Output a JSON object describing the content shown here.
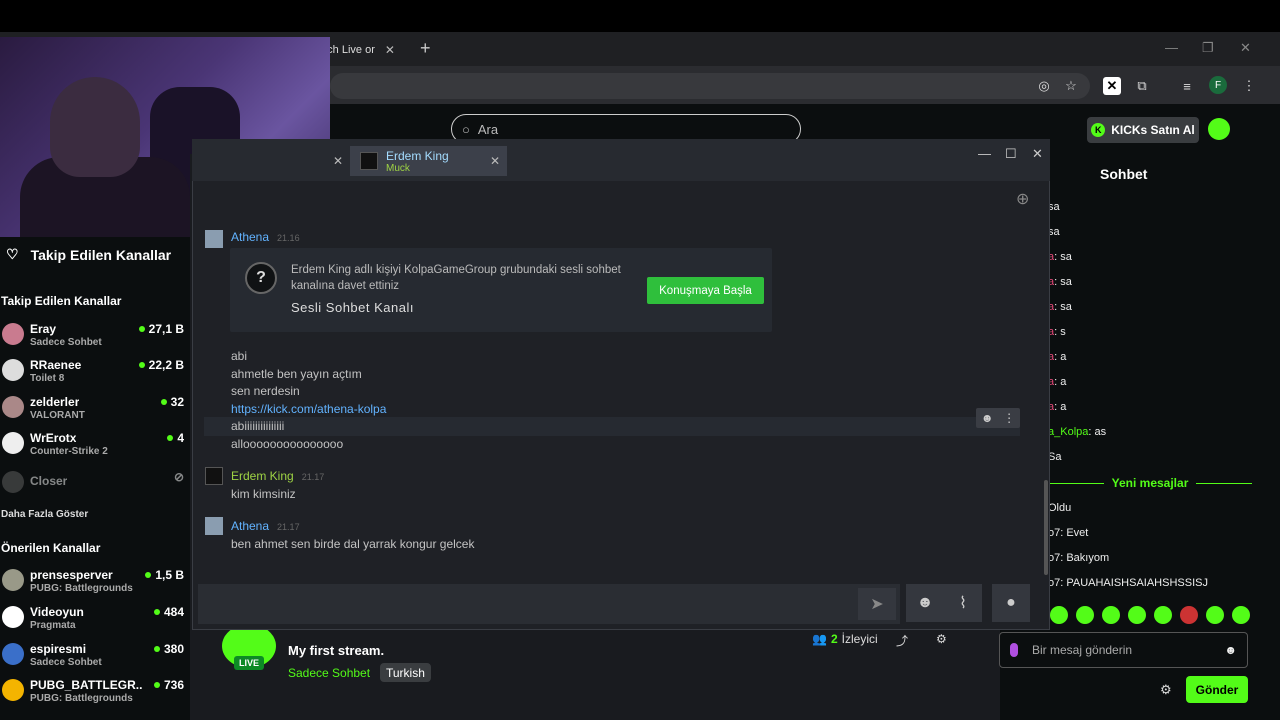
{
  "browser": {
    "tab_title": "atch Live or",
    "tab_close": "✕",
    "new_tab": "+",
    "profile_initial": "F",
    "win_min": "—",
    "win_max": "❐",
    "win_close": "✕"
  },
  "site": {
    "search_placeholder": "Ara",
    "kicks_label": "KICKs Satın Al",
    "kicks_glyph": "K"
  },
  "sidebar": {
    "header": "Takip Edilen Kanallar",
    "followed_title": "Takip Edilen Kanallar",
    "followed": [
      {
        "name": "Eray",
        "category": "Sadece Sohbet",
        "viewers": "27,1 B"
      },
      {
        "name": "RRaenee",
        "category": "Toilet 8",
        "viewers": "22,2 B"
      },
      {
        "name": "zelderler",
        "category": "VALORANT",
        "viewers": "32"
      },
      {
        "name": "WrErotx",
        "category": "Counter-Strike 2",
        "viewers": "4"
      },
      {
        "name": "Closer",
        "category": "",
        "viewers": ""
      }
    ],
    "show_more": "Daha Fazla Göster",
    "recommended_title": "Önerilen Kanallar",
    "recommended": [
      {
        "name": "prensesperver",
        "category": "PUBG: Battlegrounds",
        "viewers": "1,5 B"
      },
      {
        "name": "Videoyun",
        "category": "Pragmata",
        "viewers": "484"
      },
      {
        "name": "espiresmi",
        "category": "Sadece Sohbet",
        "viewers": "380"
      },
      {
        "name": "PUBG_BATTLEGR...",
        "category": "PUBG: Battlegrounds",
        "viewers": "736"
      }
    ]
  },
  "stream": {
    "live": "LIVE",
    "title": "My first stream.",
    "category": "Sadece Sohbet",
    "tag": "Turkish",
    "viewers_count": "2",
    "viewers_label": "İzleyici"
  },
  "chat": {
    "title": "Sohbet",
    "lines": [
      {
        "user": "",
        "text": "sa"
      },
      {
        "user": "",
        "text": "sa"
      },
      {
        "user": "a",
        "text": ": sa"
      },
      {
        "user": "a",
        "text": ": sa"
      },
      {
        "user": "a",
        "text": ": sa"
      },
      {
        "user": "a",
        "text": ": s"
      },
      {
        "user": "a",
        "text": ": a"
      },
      {
        "user": "a",
        "text": ": a"
      },
      {
        "user": "a",
        "text": ": a"
      },
      {
        "user": "a_Kolpa",
        "text": ": as"
      },
      {
        "user": "",
        "text": "Sa"
      }
    ],
    "new_messages": "Yeni mesajlar",
    "lines2": [
      {
        "text": "Oldu"
      },
      {
        "text": "o7: Evet"
      },
      {
        "text": "o7: Bakıyom"
      },
      {
        "text": "o7: PAUAHAISHSAIAHSHSSISJ"
      }
    ],
    "placeholder": "Bir mesaj gönderin",
    "send": "Gönder"
  },
  "steam": {
    "tab_name": "Erdem King",
    "tab_sub": "Muck",
    "partial_author": "Athena",
    "partial_time": "21.16",
    "invite_text": "Erdem King adlı kişiyi KolpaGameGroup grubundaki sesli sohbet kanalına davet ettiniz",
    "invite_title": "Sesli Sohbet Kanalı",
    "invite_button": "Konuşmaya Başla",
    "messages": [
      "abi",
      "ahmetle ben yayın açtım",
      "sen nerdesin"
    ],
    "link": "https://kick.com/athena-kolpa",
    "messages2": [
      "abiiiiiiiiiiiiiii",
      "allooooooooooooooo"
    ],
    "author2": "Erdem King",
    "time2": "21.17",
    "msg_author2": "kim kimsiniz",
    "author3": "Athena",
    "time3": "21.17",
    "msg_author3": "ben ahmet sen birde dal yarrak kongur gelcek"
  },
  "colors": {
    "kick_green": "#53fc18",
    "steam_bg": "#1f2126",
    "link": "#62b3ff"
  }
}
